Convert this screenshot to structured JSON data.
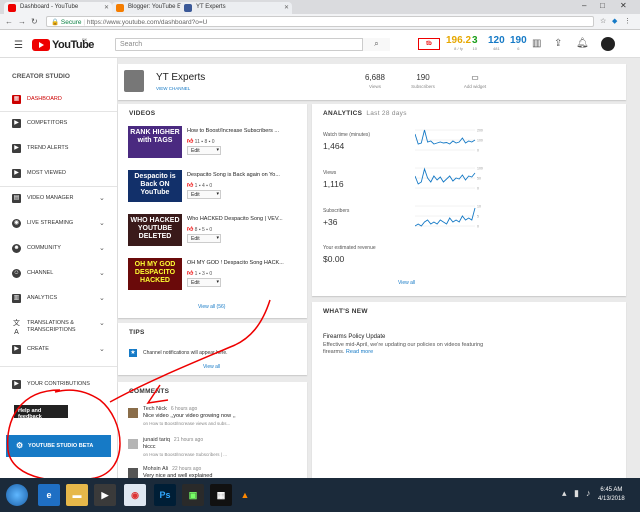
{
  "browser": {
    "tabs": [
      {
        "label": "Dashboard - YouTube",
        "color": "#e00"
      },
      {
        "label": "Blogger: YouTube Expe...",
        "color": "#f57d00"
      },
      {
        "label": "YT Experts",
        "color": "#3b5998"
      }
    ],
    "secure_label": "Secure",
    "url": "https://www.youtube.com/dashboard?o=U"
  },
  "header": {
    "logo_text": "YouTube",
    "region": "PK",
    "search_placeholder": "Search",
    "badge": "tb",
    "stats": [
      {
        "value": "196.2",
        "sub": "8 / fy",
        "color": "#e6a700"
      },
      {
        "value": "3",
        "sub": "10",
        "color": "#1a9e1a"
      },
      {
        "value": "120",
        "sub": "481",
        "color": "#167ac6"
      },
      {
        "value": "190",
        "sub": "6",
        "color": "#167ac6"
      }
    ]
  },
  "sidebar": {
    "title": "CREATOR STUDIO",
    "items": [
      {
        "label": "DASHBOARD",
        "active": true
      },
      {
        "label": "COMPETITORS"
      },
      {
        "label": "TREND ALERTS"
      },
      {
        "label": "MOST VIEWED"
      },
      {
        "label": "VIDEO MANAGER"
      },
      {
        "label": "LIVE STREAMING"
      },
      {
        "label": "COMMUNITY"
      },
      {
        "label": "CHANNEL"
      },
      {
        "label": "ANALYTICS"
      },
      {
        "label": "TRANSLATIONS & TRANSCRIPTIONS"
      },
      {
        "label": "CREATE"
      },
      {
        "label": "YOUR CONTRIBUTIONS"
      }
    ],
    "help_label": "Help and feedback",
    "studio_beta_label": "YOUTUBE STUDIO BETA"
  },
  "channel": {
    "name": "YT Experts",
    "link": "VIEW CHANNEL",
    "views": "6,688",
    "views_label": "Views",
    "subs": "190",
    "subs_label": "Subscribers",
    "widget_label": "Add widget"
  },
  "videos": {
    "title": "VIDEOS",
    "items": [
      {
        "title": "How to Boost/Increase Subscribers ...",
        "likes": "11",
        "dislikes": "8",
        "comments": "0",
        "thumb": "RANK HIGHER with TAGS"
      },
      {
        "title": "Despacito Song is Back again on Yo...",
        "likes": "1",
        "dislikes": "4",
        "comments": "0",
        "thumb": "Despacito is Back ON YouTube"
      },
      {
        "title": "Who HACKED Despacito Song | VEV...",
        "likes": "8",
        "dislikes": "5",
        "comments": "0",
        "thumb": "WHO HACKED YOUTUBE DELETED"
      },
      {
        "title": "OH MY GOD ! Despacito Song HACK...",
        "likes": "1",
        "dislikes": "3",
        "comments": "0",
        "thumb": "OH MY GOD DESPACITO HACKED"
      }
    ],
    "edit_label": "Edit",
    "view_all": "View all (56)"
  },
  "tips": {
    "title": "TIPS",
    "text": "Channel notifications will appear here.",
    "view_all": "View all"
  },
  "comments": {
    "title": "COMMENTS",
    "items": [
      {
        "name": "Tech Nick",
        "time": "6 hours ago",
        "text": "Nice video ,,your video growing now ,,",
        "on": "on How to Boost/Increase views and subs..."
      },
      {
        "name": "junaid tariq",
        "time": "21 hours ago",
        "text": "hiccc",
        "on": "on How to Boost/Increase Subscribers | ..."
      },
      {
        "name": "Mohsin Ali",
        "time": "22 hours ago",
        "text": "Very nice and well explained",
        "on": ""
      }
    ]
  },
  "analytics": {
    "title": "ANALYTICS",
    "period": "Last 28 days",
    "metrics": [
      {
        "label": "Watch time (minutes)",
        "value": "1,464",
        "ticks": [
          "200",
          "100",
          "0"
        ],
        "series": [
          160,
          60,
          70,
          200,
          80,
          90,
          60,
          70,
          80,
          70,
          75,
          60,
          90,
          70,
          80,
          120,
          70,
          90,
          80,
          100
        ]
      },
      {
        "label": "Views",
        "value": "1,116",
        "ticks": [
          "100",
          "50",
          "0"
        ],
        "series": [
          60,
          20,
          30,
          95,
          50,
          30,
          60,
          40,
          55,
          30,
          45,
          60,
          35,
          50,
          45,
          65,
          40,
          60,
          55,
          75
        ]
      },
      {
        "label": "Subscribers",
        "value": "+36",
        "ticks": [
          "10",
          "5",
          "0"
        ],
        "series": [
          0,
          1,
          0,
          2,
          3,
          1,
          2,
          1,
          3,
          2,
          1,
          4,
          2,
          3,
          2,
          5,
          3,
          4,
          3,
          9
        ]
      }
    ],
    "revenue_label": "Your estimated revenue",
    "revenue_value": "$0.00",
    "view_all": "View all"
  },
  "news": {
    "title": "WHAT'S NEW",
    "headline": "Firearms Policy Update",
    "text": "Effective mid-April, we're updating our policies on videos featuring firearms.",
    "link": "Read more"
  },
  "taskbar": {
    "time": "6:45 AM",
    "date": "4/13/2018"
  }
}
